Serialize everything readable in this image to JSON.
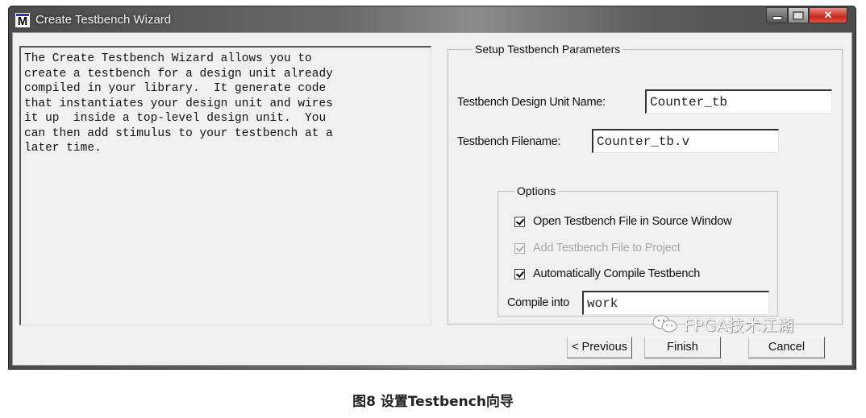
{
  "window": {
    "title": "Create Testbench Wizard",
    "icon": "modelsim-m-icon",
    "controls": {
      "minimize": "minimize-icon",
      "maximize": "maximize-icon",
      "close": "close-icon",
      "close_glyph": "✕"
    }
  },
  "description": "The Create Testbench Wizard allows you to\ncreate a testbench for a design unit already\ncompiled in your library.  It generate code\nthat instantiates your design unit and wires\nit up  inside a top-level design unit.  You\ncan then add stimulus to your testbench at a\nlater time.",
  "setup": {
    "legend": "Setup Testbench Parameters",
    "design_unit_label": "Testbench Design Unit Name:",
    "design_unit_value": "Counter_tb",
    "filename_label": "Testbench Filename:",
    "filename_value": "Counter_tb.v",
    "options": {
      "legend": "Options",
      "items": [
        {
          "label": "Open Testbench File in Source Window",
          "checked": true,
          "enabled": true
        },
        {
          "label": "Add Testbench File to Project",
          "checked": true,
          "enabled": false
        },
        {
          "label": "Automatically Compile Testbench",
          "checked": true,
          "enabled": true
        }
      ],
      "compile_into_label": "Compile into",
      "compile_into_value": "work"
    }
  },
  "buttons": {
    "previous": "< Previous",
    "finish": "Finish",
    "cancel": "Cancel"
  },
  "watermark": "FPGA技术江湖",
  "caption": "图8 设置Testbench向导"
}
